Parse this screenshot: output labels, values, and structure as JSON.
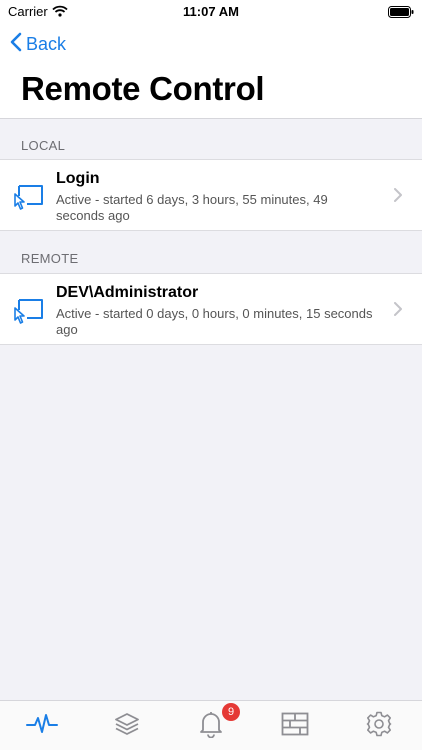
{
  "status_bar": {
    "carrier": "Carrier",
    "time": "11:07 AM"
  },
  "nav": {
    "back_label": "Back",
    "title": "Remote Control"
  },
  "sections": [
    {
      "header": "LOCAL",
      "items": [
        {
          "title": "Login",
          "subtitle": "Active - started 6 days, 3 hours, 55 minutes, 49 seconds ago",
          "icon": "remote-screen-icon"
        }
      ]
    },
    {
      "header": "REMOTE",
      "items": [
        {
          "title": "DEV\\Administrator",
          "subtitle": "Active - started 0 days, 0 hours, 0 minutes, 15 seconds ago",
          "icon": "remote-screen-icon"
        }
      ]
    }
  ],
  "tabbar": {
    "tabs": [
      {
        "icon": "activity-pulse-icon",
        "active": true
      },
      {
        "icon": "layers-icon",
        "active": false
      },
      {
        "icon": "bell-icon",
        "active": false,
        "badge": "9"
      },
      {
        "icon": "server-rack-icon",
        "active": false
      },
      {
        "icon": "gear-icon",
        "active": false
      }
    ]
  },
  "colors": {
    "accent": "#1a7ee6",
    "badge": "#e53935",
    "inactive_icon": "#8e8e93"
  }
}
